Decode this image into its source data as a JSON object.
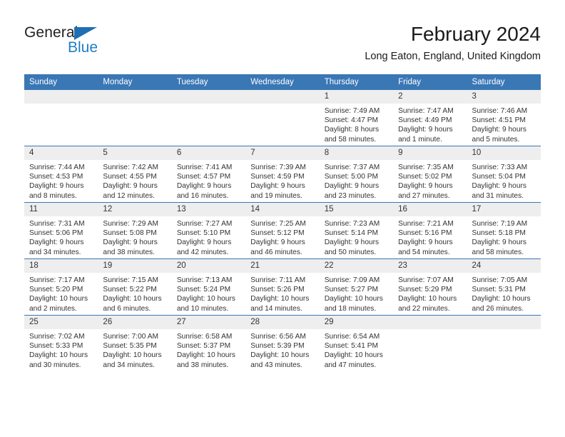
{
  "brand": {
    "name_part1": "General",
    "name_part2": "Blue",
    "triangle_color": "#1f6fb4",
    "text_color": "#231f20",
    "blue_color": "#1f7ec4"
  },
  "header": {
    "title": "February 2024",
    "subtitle": "Long Eaton, England, United Kingdom"
  },
  "theme": {
    "header_blue": "#3a77b5",
    "daynum_gray": "#eeeeee",
    "text": "#333333"
  },
  "weekdays": [
    "Sunday",
    "Monday",
    "Tuesday",
    "Wednesday",
    "Thursday",
    "Friday",
    "Saturday"
  ],
  "weeks": [
    [
      {
        "day": "",
        "blank": true
      },
      {
        "day": "",
        "blank": true
      },
      {
        "day": "",
        "blank": true
      },
      {
        "day": "",
        "blank": true
      },
      {
        "day": "1",
        "sunrise": "Sunrise: 7:49 AM",
        "sunset": "Sunset: 4:47 PM",
        "daylight1": "Daylight: 8 hours",
        "daylight2": "and 58 minutes."
      },
      {
        "day": "2",
        "sunrise": "Sunrise: 7:47 AM",
        "sunset": "Sunset: 4:49 PM",
        "daylight1": "Daylight: 9 hours",
        "daylight2": "and 1 minute."
      },
      {
        "day": "3",
        "sunrise": "Sunrise: 7:46 AM",
        "sunset": "Sunset: 4:51 PM",
        "daylight1": "Daylight: 9 hours",
        "daylight2": "and 5 minutes."
      }
    ],
    [
      {
        "day": "4",
        "sunrise": "Sunrise: 7:44 AM",
        "sunset": "Sunset: 4:53 PM",
        "daylight1": "Daylight: 9 hours",
        "daylight2": "and 8 minutes."
      },
      {
        "day": "5",
        "sunrise": "Sunrise: 7:42 AM",
        "sunset": "Sunset: 4:55 PM",
        "daylight1": "Daylight: 9 hours",
        "daylight2": "and 12 minutes."
      },
      {
        "day": "6",
        "sunrise": "Sunrise: 7:41 AM",
        "sunset": "Sunset: 4:57 PM",
        "daylight1": "Daylight: 9 hours",
        "daylight2": "and 16 minutes."
      },
      {
        "day": "7",
        "sunrise": "Sunrise: 7:39 AM",
        "sunset": "Sunset: 4:59 PM",
        "daylight1": "Daylight: 9 hours",
        "daylight2": "and 19 minutes."
      },
      {
        "day": "8",
        "sunrise": "Sunrise: 7:37 AM",
        "sunset": "Sunset: 5:00 PM",
        "daylight1": "Daylight: 9 hours",
        "daylight2": "and 23 minutes."
      },
      {
        "day": "9",
        "sunrise": "Sunrise: 7:35 AM",
        "sunset": "Sunset: 5:02 PM",
        "daylight1": "Daylight: 9 hours",
        "daylight2": "and 27 minutes."
      },
      {
        "day": "10",
        "sunrise": "Sunrise: 7:33 AM",
        "sunset": "Sunset: 5:04 PM",
        "daylight1": "Daylight: 9 hours",
        "daylight2": "and 31 minutes."
      }
    ],
    [
      {
        "day": "11",
        "sunrise": "Sunrise: 7:31 AM",
        "sunset": "Sunset: 5:06 PM",
        "daylight1": "Daylight: 9 hours",
        "daylight2": "and 34 minutes."
      },
      {
        "day": "12",
        "sunrise": "Sunrise: 7:29 AM",
        "sunset": "Sunset: 5:08 PM",
        "daylight1": "Daylight: 9 hours",
        "daylight2": "and 38 minutes."
      },
      {
        "day": "13",
        "sunrise": "Sunrise: 7:27 AM",
        "sunset": "Sunset: 5:10 PM",
        "daylight1": "Daylight: 9 hours",
        "daylight2": "and 42 minutes."
      },
      {
        "day": "14",
        "sunrise": "Sunrise: 7:25 AM",
        "sunset": "Sunset: 5:12 PM",
        "daylight1": "Daylight: 9 hours",
        "daylight2": "and 46 minutes."
      },
      {
        "day": "15",
        "sunrise": "Sunrise: 7:23 AM",
        "sunset": "Sunset: 5:14 PM",
        "daylight1": "Daylight: 9 hours",
        "daylight2": "and 50 minutes."
      },
      {
        "day": "16",
        "sunrise": "Sunrise: 7:21 AM",
        "sunset": "Sunset: 5:16 PM",
        "daylight1": "Daylight: 9 hours",
        "daylight2": "and 54 minutes."
      },
      {
        "day": "17",
        "sunrise": "Sunrise: 7:19 AM",
        "sunset": "Sunset: 5:18 PM",
        "daylight1": "Daylight: 9 hours",
        "daylight2": "and 58 minutes."
      }
    ],
    [
      {
        "day": "18",
        "sunrise": "Sunrise: 7:17 AM",
        "sunset": "Sunset: 5:20 PM",
        "daylight1": "Daylight: 10 hours",
        "daylight2": "and 2 minutes."
      },
      {
        "day": "19",
        "sunrise": "Sunrise: 7:15 AM",
        "sunset": "Sunset: 5:22 PM",
        "daylight1": "Daylight: 10 hours",
        "daylight2": "and 6 minutes."
      },
      {
        "day": "20",
        "sunrise": "Sunrise: 7:13 AM",
        "sunset": "Sunset: 5:24 PM",
        "daylight1": "Daylight: 10 hours",
        "daylight2": "and 10 minutes."
      },
      {
        "day": "21",
        "sunrise": "Sunrise: 7:11 AM",
        "sunset": "Sunset: 5:26 PM",
        "daylight1": "Daylight: 10 hours",
        "daylight2": "and 14 minutes."
      },
      {
        "day": "22",
        "sunrise": "Sunrise: 7:09 AM",
        "sunset": "Sunset: 5:27 PM",
        "daylight1": "Daylight: 10 hours",
        "daylight2": "and 18 minutes."
      },
      {
        "day": "23",
        "sunrise": "Sunrise: 7:07 AM",
        "sunset": "Sunset: 5:29 PM",
        "daylight1": "Daylight: 10 hours",
        "daylight2": "and 22 minutes."
      },
      {
        "day": "24",
        "sunrise": "Sunrise: 7:05 AM",
        "sunset": "Sunset: 5:31 PM",
        "daylight1": "Daylight: 10 hours",
        "daylight2": "and 26 minutes."
      }
    ],
    [
      {
        "day": "25",
        "sunrise": "Sunrise: 7:02 AM",
        "sunset": "Sunset: 5:33 PM",
        "daylight1": "Daylight: 10 hours",
        "daylight2": "and 30 minutes."
      },
      {
        "day": "26",
        "sunrise": "Sunrise: 7:00 AM",
        "sunset": "Sunset: 5:35 PM",
        "daylight1": "Daylight: 10 hours",
        "daylight2": "and 34 minutes."
      },
      {
        "day": "27",
        "sunrise": "Sunrise: 6:58 AM",
        "sunset": "Sunset: 5:37 PM",
        "daylight1": "Daylight: 10 hours",
        "daylight2": "and 38 minutes."
      },
      {
        "day": "28",
        "sunrise": "Sunrise: 6:56 AM",
        "sunset": "Sunset: 5:39 PM",
        "daylight1": "Daylight: 10 hours",
        "daylight2": "and 43 minutes."
      },
      {
        "day": "29",
        "sunrise": "Sunrise: 6:54 AM",
        "sunset": "Sunset: 5:41 PM",
        "daylight1": "Daylight: 10 hours",
        "daylight2": "and 47 minutes."
      },
      {
        "day": "",
        "blank": true
      },
      {
        "day": "",
        "blank": true
      }
    ]
  ]
}
